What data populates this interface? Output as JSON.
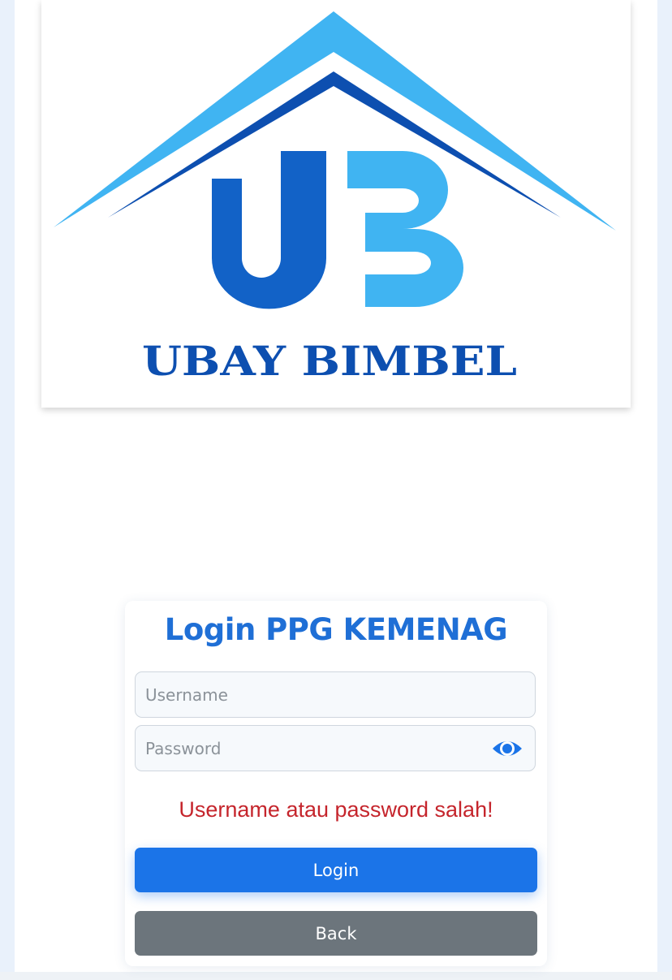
{
  "brand": {
    "logo_text": "UBAY BIMBEL",
    "colors": {
      "light_blue": "#40b4f2",
      "dark_blue": "#0d4fb0",
      "mid_blue": "#1262c7"
    }
  },
  "login": {
    "title": "Login PPG KEMENAG",
    "username_placeholder": "Username",
    "password_placeholder": "Password",
    "error_message": "Username atau password salah!",
    "login_label": "Login",
    "back_label": "Back",
    "show_password_icon": "eye-icon"
  },
  "colors": {
    "title": "#1f6fd6",
    "error": "#c5252c",
    "primary_button": "#1b74e8",
    "secondary_button": "#6c757c"
  }
}
